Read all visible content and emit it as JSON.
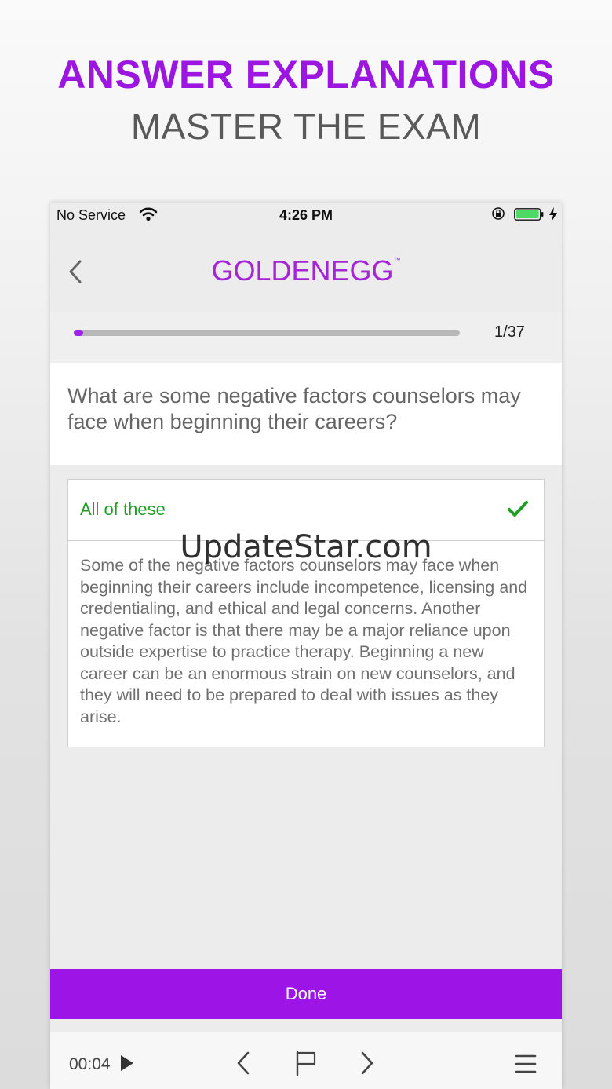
{
  "promo": {
    "headline": "ANSWER EXPLANATIONS",
    "subheadline": "MASTER THE EXAM"
  },
  "status_bar": {
    "carrier": "No Service",
    "time": "4:26 PM",
    "icons": [
      "wifi-icon",
      "orientation-lock-icon",
      "battery-icon",
      "charging-icon"
    ]
  },
  "nav": {
    "back_icon": "chevron-left-icon",
    "logo": "GOLDENEGG",
    "logo_mark": "™"
  },
  "progress": {
    "current": 1,
    "total": 37,
    "label": "1/37"
  },
  "question": {
    "text": "What are some negative factors counselors may face when beginning their careers?"
  },
  "answer": {
    "label": "All of these",
    "correct": true,
    "icon": "checkmark-icon",
    "explanation": "Some of the negative factors counselors may face when beginning their careers include incompetence, licensing and credentialing, and ethical and legal concerns. Another negative factor is that there may be a major reliance upon outside expertise to practice therapy. Beginning a new career can be an enormous strain on new counselors, and they will need to be prepared to deal with issues as they arise."
  },
  "done_button": {
    "label": "Done"
  },
  "toolbar": {
    "timer": "00:04",
    "icons": [
      "play-icon",
      "chevron-left-icon",
      "flag-icon",
      "chevron-right-icon",
      "menu-icon"
    ]
  },
  "watermark": "UpdateStar.com",
  "colors": {
    "accent_purple": "#9c14e6",
    "correct_green": "#1e9e25",
    "progress_track": "#b8b8b8"
  }
}
